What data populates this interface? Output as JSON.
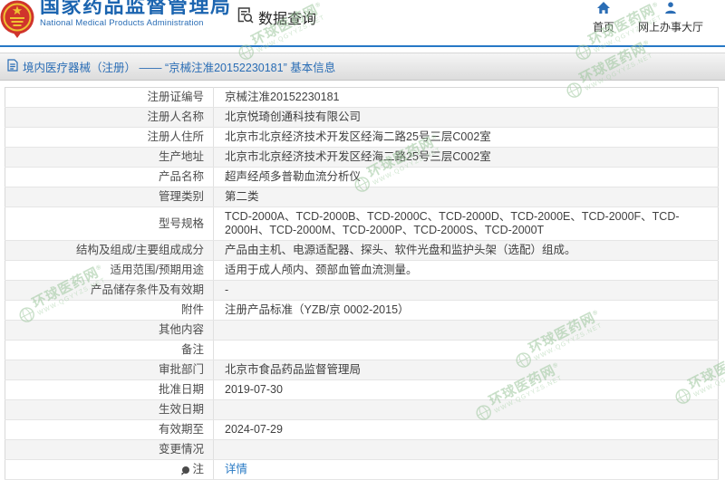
{
  "header": {
    "brand": {
      "title": "国家药品监督管理局",
      "subtitle": "National Medical Products Administration"
    },
    "section_label": "数据查询",
    "nav": [
      {
        "label": "首页"
      },
      {
        "label": "网上办事大厅"
      }
    ]
  },
  "breadcrumb": "境内医疗器械（注册） —— “京械注准20152230181” 基本信息",
  "table": {
    "rows": [
      {
        "label": "注册证编号",
        "value": "京械注准20152230181"
      },
      {
        "label": "注册人名称",
        "value": "北京悦琦创通科技有限公司"
      },
      {
        "label": "注册人住所",
        "value": "北京市北京经济技术开发区经海二路25号三层C002室"
      },
      {
        "label": "生产地址",
        "value": "北京市北京经济技术开发区经海二路25号三层C002室"
      },
      {
        "label": "产品名称",
        "value": "超声经颅多普勒血流分析仪"
      },
      {
        "label": "管理类别",
        "value": "第二类"
      },
      {
        "label": "型号规格",
        "value": "TCD-2000A、TCD-2000B、TCD-2000C、TCD-2000D、TCD-2000E、TCD-2000F、TCD-2000H、TCD-2000M、TCD-2000P、TCD-2000S、TCD-2000T"
      },
      {
        "label": "结构及组成/主要组成成分",
        "value": "产品由主机、电源适配器、探头、软件光盘和监护头架（选配）组成。"
      },
      {
        "label": "适用范围/预期用途",
        "value": "适用于成人颅内、颈部血管血流测量。"
      },
      {
        "label": "产品储存条件及有效期",
        "value": "-"
      },
      {
        "label": "附件",
        "value": "注册产品标准（YZB/京 0002-2015）"
      },
      {
        "label": "其他内容",
        "value": ""
      },
      {
        "label": "备注",
        "value": ""
      },
      {
        "label": "审批部门",
        "value": "北京市食品药品监督管理局"
      },
      {
        "label": "批准日期",
        "value": "2019-07-30"
      },
      {
        "label": "生效日期",
        "value": ""
      },
      {
        "label": "有效期至",
        "value": "2024-07-29"
      },
      {
        "label": "变更情况",
        "value": ""
      },
      {
        "label": "注",
        "value": "详情",
        "link": true,
        "icon": "note-icon"
      }
    ]
  },
  "watermark": {
    "name": "环球医药网",
    "reg": "®",
    "url": "WWW.QGYYZS.NET"
  },
  "colors": {
    "brand_blue": "#1c65b0",
    "link_blue": "#2779c4",
    "divider_blue": "#2778c6",
    "watermark_green": "#9cc69c",
    "emblem_red": "#d0342c",
    "emblem_gold": "#efc132",
    "row_alt_gray": "#f4f4f4"
  }
}
